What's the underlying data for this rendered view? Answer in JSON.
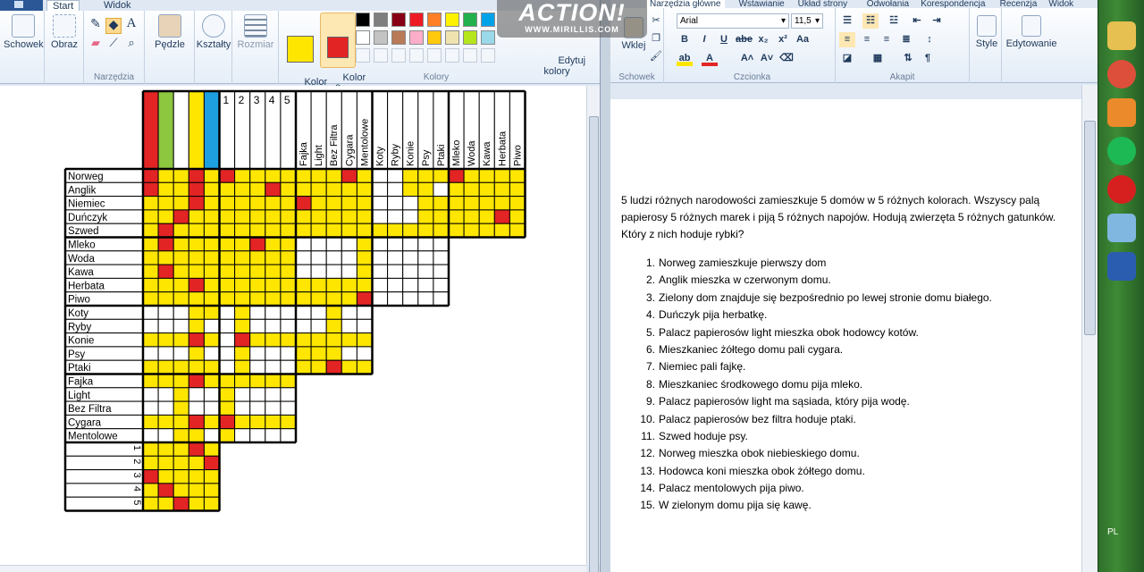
{
  "paint": {
    "tabs": {
      "file": "",
      "start": "Start",
      "view": "Widok"
    },
    "groups": {
      "tools": "Narzędzia",
      "colors": "Kolory"
    },
    "buttons": {
      "clipboard": "Schowek",
      "image": "Obraz",
      "brushes": "Pędzle",
      "shapes": "Kształty",
      "size": "Rozmiar",
      "color1": "Kolor\n1",
      "color2": "Kolor\n2",
      "edit_colors": "Edytuj\nkolory"
    },
    "color1": "#ffe600",
    "color2": "#e32424",
    "palette": [
      "#000000",
      "#7f7f7f",
      "#880015",
      "#ed1c24",
      "#ff7f27",
      "#fff200",
      "#22b14c",
      "#00a2e8",
      "#ffffff",
      "#c3c3c3",
      "#b97a57",
      "#ffaec9",
      "#ffc90e",
      "#efe4b0",
      "#b5e61d",
      "#99d9ea"
    ]
  },
  "watermark": {
    "logo": "ACTION!",
    "url": "WWW.MIRILLIS.COM"
  },
  "grid": {
    "col_numbers": [
      "1",
      "2",
      "3",
      "4",
      "5"
    ],
    "col_smoke": [
      "Fajka",
      "Light",
      "Bez Filtra",
      "Cygara",
      "Mentolowe"
    ],
    "col_pets": [
      "Koty",
      "Ryby",
      "Konie",
      "Psy",
      "Ptaki"
    ],
    "col_drinks": [
      "Mleko",
      "Woda",
      "Kawa",
      "Herbata",
      "Piwo"
    ],
    "row_nations": [
      "Norweg",
      "Anglik",
      "Niemiec",
      "Duńczyk",
      "Szwed"
    ],
    "row_drinks": [
      "Mleko",
      "Woda",
      "Kawa",
      "Herbata",
      "Piwo"
    ],
    "row_pets": [
      "Koty",
      "Ryby",
      "Konie",
      "Psy",
      "Ptaki"
    ],
    "row_smoke": [
      "Fajka",
      "Light",
      "Bez Filtra",
      "Cygara",
      "Mentolowe"
    ],
    "row_numbers": [
      "1",
      "2",
      "3",
      "4",
      "5"
    ],
    "header_colors": [
      "#e32424",
      "#8dc63f",
      "#ffffff",
      "#ffe600",
      "#1e9fe0"
    ],
    "cell_yellow": "#ffe600",
    "cell_red": "#e32424",
    "block_nations": [
      "RYYRY",
      "RYYRY",
      "YYYRY",
      "YYRYY",
      "YRYYY"
    ],
    "block_nations_num": [
      "RYYYY",
      "YYYRY",
      "YYYYY",
      "YYYYY",
      "YYYYY"
    ],
    "block_nations_smoke": [
      "YYYRY",
      "YYYYY",
      "RYYYY",
      "YYYYY",
      "YYYYY"
    ],
    "block_nations_pets": [
      "WWYYY",
      "WWYYW",
      "WWWYY",
      "WWWYY",
      "YYYYY"
    ],
    "block_nations_drinks": [
      "RYYYY",
      "YYYYY",
      "YYYYY",
      "YYYRY",
      "YYYYY"
    ],
    "block_drinks": [
      "YRYYY",
      "YYYYY",
      "YRYYY",
      "YYYRY",
      "YYYYY"
    ],
    "block_drinks_num": [
      "YYRYY",
      "YYYYY",
      "YYYYY",
      "YYYYY",
      "YYYYY"
    ],
    "block_drinks_smoke": [
      "WWWWY",
      "WWWWY",
      "WWWWY",
      "YYYYY",
      "YYYYR"
    ],
    "block_drinks_pets": [
      "WWWWW",
      "WWWWW",
      "WWWWW",
      "WWWWW",
      "WWWWW"
    ],
    "block_pets": [
      "WWWYY",
      "WWWYW",
      "YYYRY",
      "WWWYW",
      "YYYYY"
    ],
    "block_pets_num": [
      "WYWWW",
      "WYWWW",
      "WRYYY",
      "WYWWW",
      "WYWWW"
    ],
    "block_pets_smoke": [
      "WWYWW",
      "WWYWW",
      "YYYYY",
      "YYYWW",
      "YYRYY"
    ],
    "block_smoke": [
      "YYYRY",
      "WWYWW",
      "WWYWW",
      "YYYRY",
      "WWYYW"
    ],
    "block_smoke_num": [
      "YYYYY",
      "YWWWW",
      "YWWWW",
      "RYYYY",
      "YWWWW"
    ],
    "block_num": [
      "YYYRY",
      "YYYYR",
      "RYYYY",
      "YRYYY",
      "YYRYY"
    ]
  },
  "word": {
    "tabs": [
      "Narzędzia główne",
      "Wstawianie",
      "Układ strony",
      "Odwołania",
      "Korespondencja",
      "Recenzja",
      "Widok"
    ],
    "groups": {
      "clipboard": "Schowek",
      "font": "Czcionka",
      "paragraph": "Akapit",
      "styles": "Style",
      "editing": "Edytowanie"
    },
    "paste": "Wklej",
    "font_name": "Arial",
    "font_size": "11,5",
    "format_buttons": [
      "B",
      "I",
      "U",
      "abe",
      "x₂",
      "x²",
      "Aa"
    ],
    "intro": "5 ludzi różnych narodowości zamieszkuje  5 domów w 5 różnych kolorach. Wszyscy palą papierosy 5 różnych marek  i piją 5 różnych napojów. Hodują zwierzęta  5 różnych gatunków. Który z nich hoduje rybki?",
    "clues": [
      "Norweg zamieszkuje  pierwszy  dom",
      "Anglik mieszka w czerwonym domu.",
      "Zielony dom znajduje  się bezpośrednio po lewej stronie domu białego.",
      "Duńczyk pija herbatkę.",
      "Palacz papierosów light mieszka  obok hodowcy kotów.",
      "Mieszkaniec żółtego domu pali cygara.",
      "Niemiec pali fajkę.",
      "Mieszkaniec środkowego domu pija mleko.",
      "Palacz papierosów light ma sąsiada, który pija wodę.",
      "Palacz papierosów bez  filtra hoduje ptaki.",
      "Szwed hoduje psy.",
      "Norweg mieszka  obok niebieskiego domu.",
      "Hodowca koni mieszka  obok żółtego domu.",
      "Palacz mentolowych pija piwo.",
      "W zielonym  domu pija się kawę."
    ]
  },
  "taskbar": {
    "lang": "PL",
    "icons": [
      "explorer-icon",
      "chrome-icon",
      "media-player-icon",
      "spotify-icon",
      "record-icon",
      "paint-icon",
      "word-icon"
    ]
  }
}
